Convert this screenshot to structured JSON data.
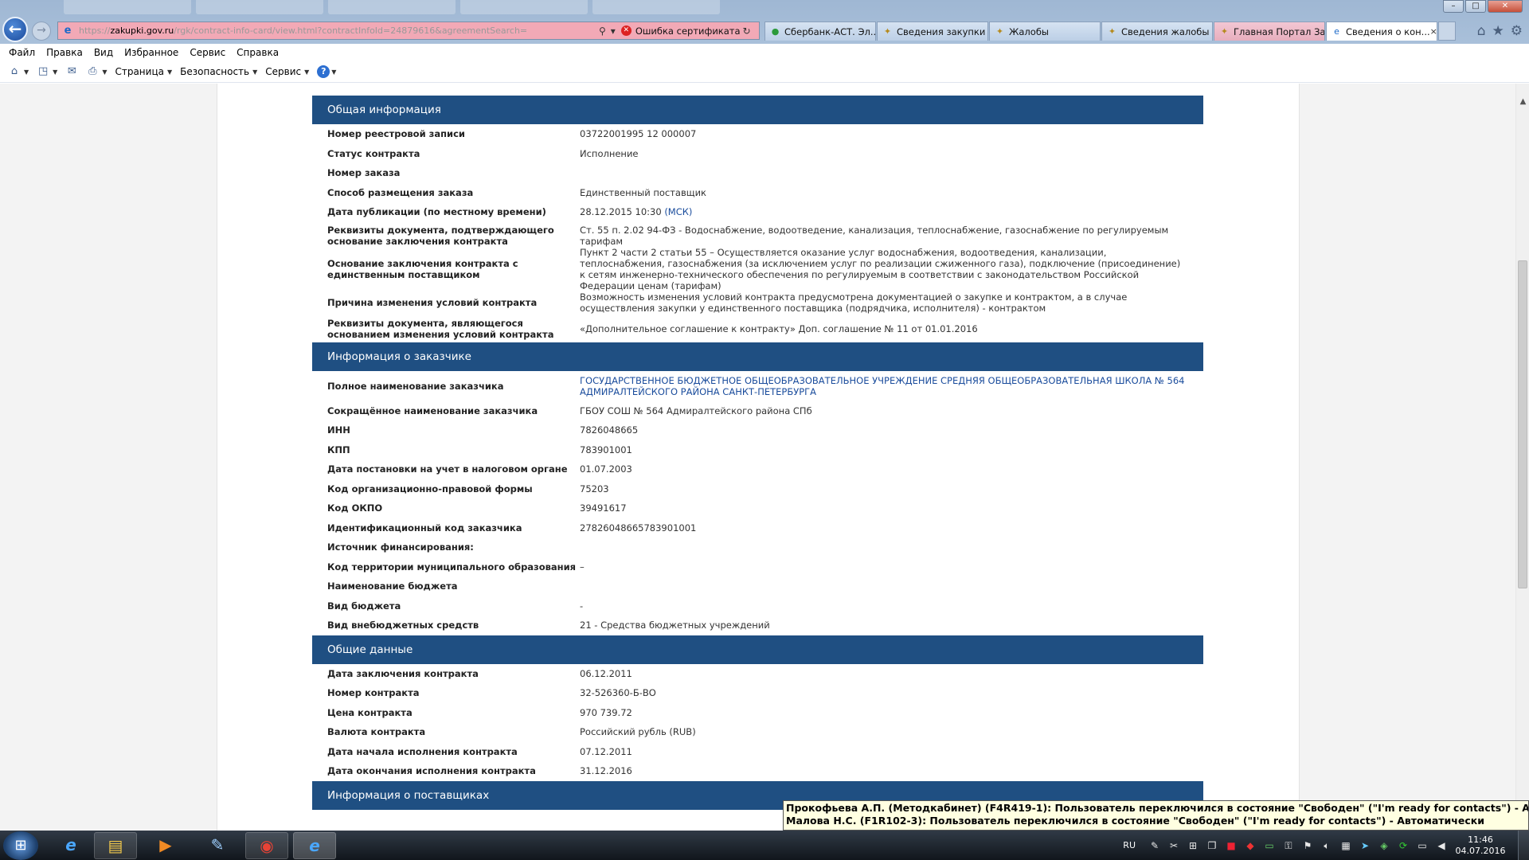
{
  "browser": {
    "url_prefix": "https://",
    "url_domain": "zakupki.gov.ru",
    "url_path": "/rgk/contract-info-card/view.html?contractInfoId=24879616&agreementSearch=",
    "cert_error": "Ошибка сертификата",
    "tabs": [
      {
        "label": "Сбербанк-АСТ. Эл...",
        "icon": "sberbank-icon"
      },
      {
        "label": "Сведения закупки",
        "icon": "emblem-icon"
      },
      {
        "label": "Жалобы",
        "icon": "emblem-icon"
      },
      {
        "label": "Сведения жалобы",
        "icon": "emblem-icon"
      },
      {
        "label": "Главная Портал За...",
        "icon": "emblem-icon"
      },
      {
        "label": "Сведения о кон...",
        "icon": "ie-page-icon"
      }
    ],
    "tab_close": "×",
    "menu": [
      "Файл",
      "Правка",
      "Вид",
      "Избранное",
      "Сервис",
      "Справка"
    ],
    "commands": {
      "page": "Страница",
      "safety": "Безопасность",
      "tools": "Сервис"
    }
  },
  "sections": [
    {
      "title": "Общая информация",
      "rows": [
        {
          "label": "Номер реестровой записи",
          "value": "03722001995 12 000007"
        },
        {
          "label": "Статус контракта",
          "value": "Исполнение"
        },
        {
          "label": "Номер заказа",
          "value": ""
        },
        {
          "label": "Способ размещения заказа",
          "value": "Единственный поставщик"
        },
        {
          "label": "Дата публикации (по местному времени)",
          "value": "28.12.2015 10:30",
          "value_link": "(МСК)"
        },
        {
          "label": "Реквизиты документа, подтверждающего основание заключения контракта",
          "value": "Ст. 55 п. 2.02 94-ФЗ - Водоснабжение, водоотведение, канализация, теплоснабжение, газоснабжение по регулируемым тарифам"
        },
        {
          "label": "Основание заключения контракта с единственным поставщиком",
          "value": "Пункт 2 части 2 статьи 55 – Осуществляется оказание услуг водоснабжения, водоотведения, канализации, теплоснабжения, газоснабжения (за исключением услуг по реализации сжиженного газа), подключение (присоединение) к сетям инженерно-технического обеспечения по регулируемым в соответствии с законодательством Российской Федерации ценам (тарифам)"
        },
        {
          "label": "Причина изменения условий контракта",
          "value": "Возможность изменения условий контракта предусмотрена документацией о закупке и контрактом, а в случае осуществления закупки у единственного поставщика (подрядчика, исполнителя) - контрактом"
        },
        {
          "label": "Реквизиты документа, являющегося основанием изменения условий контракта",
          "value": "«Дополнительное соглашение к контракту» Доп. соглашение № 11 от 01.01.2016"
        }
      ]
    },
    {
      "title": "Информация о заказчике",
      "rows": [
        {
          "label": "Полное наименование заказчика",
          "value": "ГОСУДАРСТВЕННОЕ БЮДЖЕТНОЕ ОБЩЕОБРАЗОВАТЕЛЬНОЕ УЧРЕЖДЕНИЕ СРЕДНЯЯ ОБЩЕОБРАЗОВАТЕЛЬНАЯ ШКОЛА № 564 АДМИРАЛТЕЙСКОГО РАЙОНА САНКТ-ПЕТЕРБУРГА",
          "is_link": true
        },
        {
          "label": "Сокращённое наименование заказчика",
          "value": "ГБОУ СОШ № 564 Адмиралтейского района СПб"
        },
        {
          "label": "ИНН",
          "value": "7826048665"
        },
        {
          "label": "КПП",
          "value": "783901001"
        },
        {
          "label": "Дата постановки на учет в налоговом органе",
          "value": "01.07.2003"
        },
        {
          "label": "Код организационно-правовой формы",
          "value": "75203"
        },
        {
          "label": "Код ОКПО",
          "value": "39491617"
        },
        {
          "label": "Идентификационный код заказчика",
          "value": "27826048665783901001"
        },
        {
          "label": "Источник финансирования:",
          "value": ""
        },
        {
          "label": "Код территории муниципального образования",
          "value": " –"
        },
        {
          "label": "Наименование бюджета",
          "value": ""
        },
        {
          "label": "Вид бюджета",
          "value": "-"
        },
        {
          "label": "Вид внебюджетных средств",
          "value": "21 - Средства бюджетных учреждений"
        }
      ]
    },
    {
      "title": "Общие данные",
      "rows": [
        {
          "label": "Дата заключения контракта",
          "value": "06.12.2011"
        },
        {
          "label": "Номер контракта",
          "value": "32-526360-Б-ВО"
        },
        {
          "label": "Цена контракта",
          "value": "970 739.72"
        },
        {
          "label": "Валюта контракта",
          "value": "Российский рубль (RUB)"
        },
        {
          "label": "Дата начала исполнения контракта",
          "value": "07.12.2011"
        },
        {
          "label": "Дата окончания исполнения контракта",
          "value": "31.12.2016"
        }
      ]
    },
    {
      "title": "Информация о поставщиках",
      "rows": []
    }
  ],
  "notification": [
    "Прокофьева А.П. (Методкабинет) (F4R419-1): Пользователь переключился в состояние \"Свободен\" (\"I'm ready for contacts\") - Автоматически",
    "Малова Н.С. (F1R102-3): Пользователь переключился в состояние \"Свободен\" (\"I'm ready for contacts\") - Автоматически"
  ],
  "taskbar": {
    "language": "RU",
    "time": "11:46",
    "date": "04.07.2016",
    "apps": [
      "ie-icon",
      "file-explorer-icon",
      "media-player-icon",
      "notepad-icon",
      "chrome-icon",
      "ie-icon"
    ]
  },
  "colors": {
    "section_header_bg": "#1f4f82",
    "link": "#1a4c9c",
    "address_bar_error": "#f2a9b6"
  }
}
